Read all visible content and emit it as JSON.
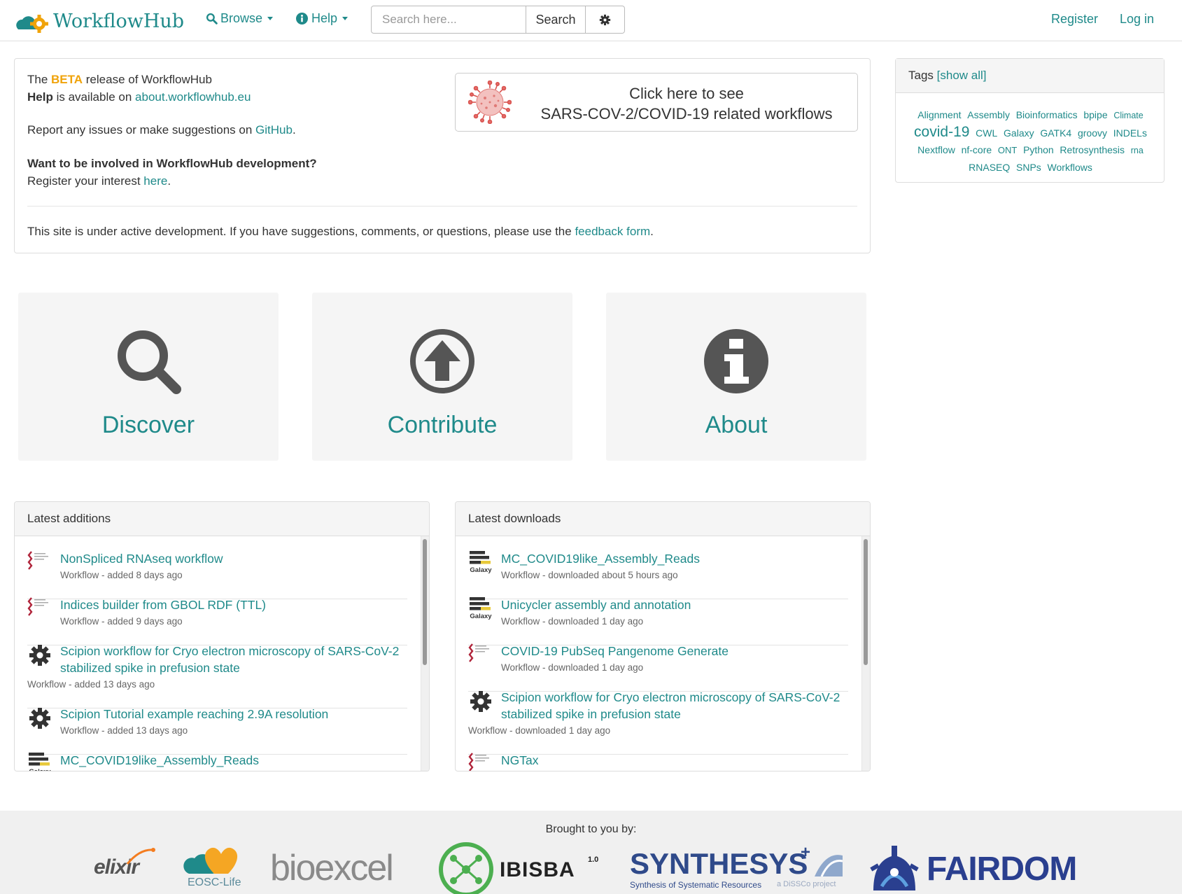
{
  "navbar": {
    "brand": "WorkflowHub",
    "browse_label": "Browse",
    "help_label": "Help",
    "search_placeholder": "Search here...",
    "search_button": "Search",
    "register": "Register",
    "login": "Log in"
  },
  "info": {
    "beta_pre": "The ",
    "beta_word": "BETA",
    "beta_post": " release of WorkflowHub",
    "help_word": "Help",
    "help_mid": " is available on ",
    "help_link": "about.workflowhub.eu",
    "report_pre": "Report any issues or make suggestions on ",
    "report_link": "GitHub",
    "report_post": ".",
    "involved": "Want to be involved in WorkflowHub development?",
    "register_pre": "Register your interest ",
    "register_link": "here",
    "register_post": ".",
    "dev_pre": "This site is under active development. If you have suggestions, comments, or questions, please use the ",
    "dev_link": "feedback form",
    "dev_post": ".",
    "covid_line1": "Click here to see",
    "covid_line2": "SARS-COV-2/COVID-19 related workflows"
  },
  "tags": {
    "heading": "Tags",
    "show_all": "[show all]",
    "items": [
      {
        "label": "Alignment",
        "size": 14
      },
      {
        "label": "Assembly",
        "size": 14
      },
      {
        "label": "Bioinformatics",
        "size": 14
      },
      {
        "label": "bpipe",
        "size": 14
      },
      {
        "label": "Climate",
        "size": 12.5
      },
      {
        "label": "covid-19",
        "size": 21
      },
      {
        "label": "CWL",
        "size": 14
      },
      {
        "label": "Galaxy",
        "size": 14
      },
      {
        "label": "GATK4",
        "size": 14
      },
      {
        "label": "groovy",
        "size": 14
      },
      {
        "label": "INDELs",
        "size": 14
      },
      {
        "label": "Nextflow",
        "size": 14
      },
      {
        "label": "nf-core",
        "size": 14
      },
      {
        "label": "ONT",
        "size": 13
      },
      {
        "label": "Python",
        "size": 14
      },
      {
        "label": "Retrosynthesis",
        "size": 14
      },
      {
        "label": "rna",
        "size": 12.5
      },
      {
        "label": "RNASEQ",
        "size": 14
      },
      {
        "label": "SNPs",
        "size": 14
      },
      {
        "label": "Workflows",
        "size": 14
      }
    ]
  },
  "tiles": {
    "discover": "Discover",
    "contribute": "Contribute",
    "about": "About"
  },
  "additions": {
    "heading": "Latest additions",
    "items": [
      {
        "title": "NonSpliced RNAseq workflow",
        "meta": "Workflow - added 8 days ago",
        "icon": "cwl-icon"
      },
      {
        "title": "Indices builder from GBOL RDF (TTL)",
        "meta": "Workflow - added 9 days ago",
        "icon": "cwl-icon"
      },
      {
        "title": "Scipion workflow for Cryo electron microscopy of SARS-CoV-2 stabilized spike in prefusion state",
        "meta": "Workflow - added 13 days ago",
        "icon": "gear-icon"
      },
      {
        "title": "Scipion Tutorial example reaching 2.9A resolution",
        "meta": "Workflow - added 13 days ago",
        "icon": "gear-icon"
      },
      {
        "title": "MC_COVID19like_Assembly_Reads",
        "meta": "",
        "icon": "galaxy-icon"
      }
    ]
  },
  "downloads": {
    "heading": "Latest downloads",
    "items": [
      {
        "title": "MC_COVID19like_Assembly_Reads",
        "meta": "Workflow - downloaded about 5 hours ago",
        "icon": "galaxy-icon"
      },
      {
        "title": "Unicycler assembly and annotation",
        "meta": "Workflow - downloaded 1 day ago",
        "icon": "galaxy-icon"
      },
      {
        "title": "COVID-19 PubSeq Pangenome Generate",
        "meta": "Workflow - downloaded 1 day ago",
        "icon": "cwl-icon"
      },
      {
        "title": "Scipion workflow for Cryo electron microscopy of SARS-CoV-2 stabilized spike in prefusion state",
        "meta": "Workflow - downloaded 1 day ago",
        "icon": "gear-icon"
      },
      {
        "title": "NGTax",
        "meta": "",
        "icon": "cwl-icon"
      }
    ]
  },
  "footer": {
    "brought": "Brought to you by:",
    "logos": {
      "elixir": "elixir",
      "eosc": "EOSC-Life",
      "bioexcel": "bioexcel",
      "ibisba": "IBISBA",
      "ibisba_version": "1.0",
      "synthesys": "SYNTHESYS",
      "synthesys_plus": "+",
      "synthesys_sub": "Synthesis of Systematic Resources",
      "synthesys_dissco": "a DiSSCo project",
      "fairdom": "FAIRDOM"
    }
  },
  "colors": {
    "accent": "#1f8a8a",
    "beta": "#f0a30a",
    "icon_dark": "#555555"
  }
}
